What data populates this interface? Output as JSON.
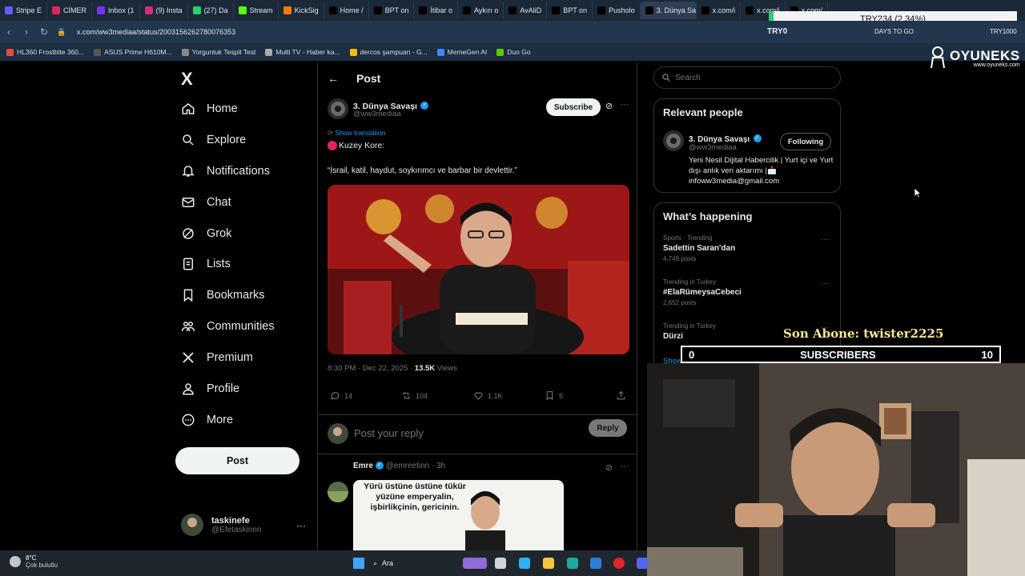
{
  "browser": {
    "tabs": [
      {
        "label": "Stripe E",
        "color": "#635bff"
      },
      {
        "label": "CİMER",
        "color": "#e0245e"
      },
      {
        "label": "Inbox (1",
        "color": "#7b2ff7"
      },
      {
        "label": "(9) Insta",
        "color": "#d62976"
      },
      {
        "label": "(27) Da",
        "color": "#25d366"
      },
      {
        "label": "Stream",
        "color": "#53fc18"
      },
      {
        "label": "KickSig",
        "color": "#ff7a00"
      },
      {
        "label": "Home /",
        "color": "#000000"
      },
      {
        "label": "BPT on",
        "color": "#000000"
      },
      {
        "label": "İtibar o",
        "color": "#000000"
      },
      {
        "label": "Aykırı o",
        "color": "#000000"
      },
      {
        "label": "AvAliD",
        "color": "#000000"
      },
      {
        "label": "BPT on",
        "color": "#000000"
      },
      {
        "label": "Pusholo",
        "color": "#000000"
      },
      {
        "label": "3. Dünya Sava",
        "color": "#000000",
        "active": true
      },
      {
        "label": "x.com/i",
        "color": "#000000"
      },
      {
        "label": "x.com/i",
        "color": "#000000"
      },
      {
        "label": "x.com/",
        "color": "#000000"
      }
    ],
    "url": "x.com/ww3mediaa/status/2003156262780076353",
    "bookmarks": [
      {
        "label": "HL360 Frostbite 360...",
        "color": "#e74c3c"
      },
      {
        "label": "ASUS Prime H610M...",
        "color": "#555555"
      },
      {
        "label": "Yorgunluk Tespit Test",
        "color": "#888888"
      },
      {
        "label": "Multi TV - Haber ka...",
        "color": "#aaaaaa"
      },
      {
        "label": "dercos şampuan - G...",
        "color": "#fbbc05"
      },
      {
        "label": "MemeGen AI",
        "color": "#4285f4"
      },
      {
        "label": "Duo Go",
        "color": "#58cc02"
      }
    ]
  },
  "ticker": {
    "text": "TRY234 (2.34%)",
    "label": "TRY0",
    "days": "DAYS TO GO",
    "right": "TRY1000"
  },
  "overlay_brand": {
    "name": "OYUNEKS",
    "url": "www.oyuneks.com"
  },
  "nav": {
    "logo": "X",
    "items": [
      "Home",
      "Explore",
      "Notifications",
      "Chat",
      "Grok",
      "Lists",
      "Bookmarks",
      "Communities",
      "Premium",
      "Profile",
      "More"
    ],
    "post_button": "Post",
    "account_name": "taskinefe",
    "account_handle": "@Efetaskinnn",
    "more_dots": "···"
  },
  "post": {
    "header": "Post",
    "author_name": "3. Dünya Savaşı",
    "author_handle": "@ww3mediaa",
    "subscribe": "Subscribe",
    "show_translation": "Show translation",
    "line1": "Kuzey Kore:",
    "line2": "“İsrail, katil, haydut, soykırımcı ve barbar bir devlettir.”",
    "time": "8:30 PM · Dec 22, 2025 · ",
    "views_count": "13.5K",
    "views_label": " Views",
    "stats": {
      "replies": "14",
      "reposts": "104",
      "likes": "1.1K",
      "bookmarks": "5"
    },
    "reply_placeholder": "Post your reply",
    "reply_button": "Reply"
  },
  "reply": {
    "author_name": "Emre",
    "author_handle": "@emreetinn · 3h",
    "image_text": "Yürü üstüne üstüne tükür yüzüne emperyalin, işbirlikçinin, gericinin."
  },
  "sidebar": {
    "search_placeholder": "Search",
    "relevant_title": "Relevant people",
    "person_name": "3. Dünya Savaşı",
    "person_handle": "@ww3mediaa",
    "following": "Following",
    "bio": "Yeni Nesil Dijital Habercilik | Yurt içi ve Yurt dışı anlık veri aktarımı |📩 infoww3media@gmail.com",
    "happening_title": "What’s happening",
    "trends": [
      {
        "category": "Sports · Trending",
        "name": "Sadettin Saran'dan",
        "count": "4,749 posts"
      },
      {
        "category": "Trending in Turkey",
        "name": "#ElaRümeysaCebeci",
        "count": "2,652 posts"
      },
      {
        "category": "Trending in Turkey",
        "name": "Dürzi",
        "count": ""
      }
    ],
    "show_more": "Show more"
  },
  "stream": {
    "son_abone": "Son Abone: twister2225",
    "subs_left": "0",
    "subs_label": "SUBSCRIBERS",
    "subs_right": "10"
  },
  "taskbar": {
    "weather_temp": "8°C",
    "weather_desc": "Çok bulutlu",
    "search": "Ara"
  }
}
